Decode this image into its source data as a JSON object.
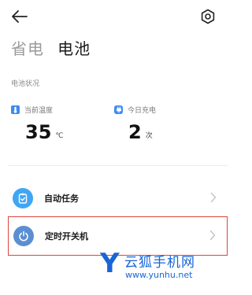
{
  "header": {
    "tabs": [
      {
        "label": "省电"
      },
      {
        "label": "电池"
      }
    ]
  },
  "battery_status": {
    "section_label": "电池状况",
    "temperature": {
      "label": "当前温度",
      "value": "35",
      "unit": "℃"
    },
    "charges_today": {
      "label": "今日充电",
      "value": "2",
      "unit": "次"
    }
  },
  "menu": {
    "items": [
      {
        "label": "自动任务",
        "icon": "clipboard-check-icon"
      },
      {
        "label": "定时开关机",
        "icon": "power-icon"
      }
    ]
  },
  "watermark": {
    "letter": "Y",
    "brand": "云狐手机网",
    "url": "www.yunhu.net"
  },
  "colors": {
    "accent_blue": "#3d8bf2",
    "highlight_border": "#d9463c",
    "watermark_blue": "#1a64d6"
  }
}
